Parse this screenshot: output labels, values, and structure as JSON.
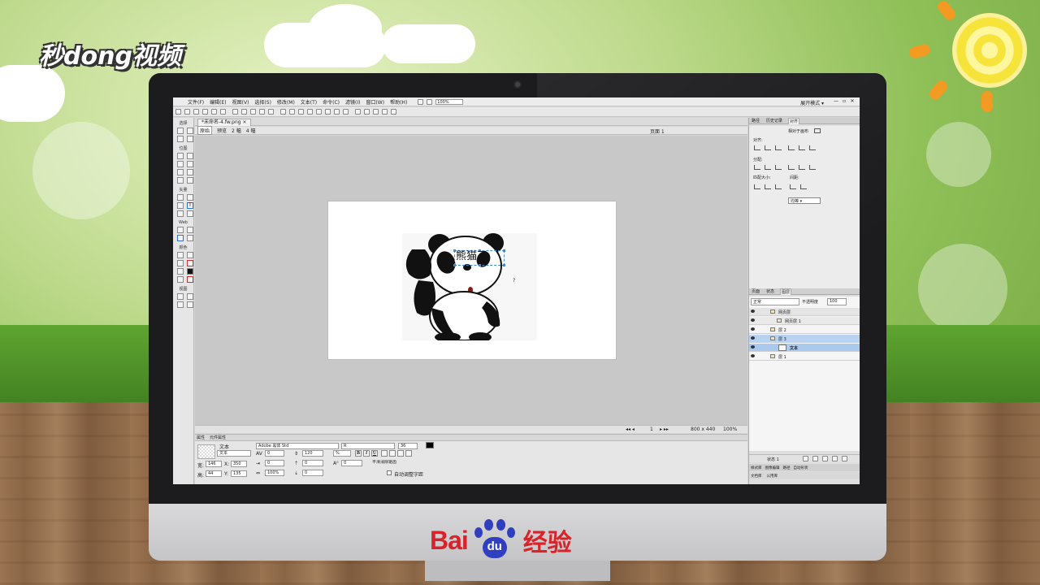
{
  "brand": {
    "logo_text": "秒dong视频"
  },
  "watermark": {
    "bai": "Bai",
    "du": "du",
    "jingyan": "经验"
  },
  "app": {
    "menu": [
      "文件(F)",
      "编辑(E)",
      "视图(V)",
      "选择(S)",
      "修改(M)",
      "文本(T)",
      "命令(C)",
      "滤镜(I)",
      "窗口(W)",
      "帮助(H)"
    ],
    "zoom": "100%",
    "workspace_mode": "展开模式 ▾",
    "window_buttons": [
      "—",
      "▫",
      "✕"
    ],
    "doc_tab": "*未命名-4.fw.png ×",
    "views": {
      "original": "原始",
      "preview": "预览",
      "two_up": "2 幅",
      "four_up": "4 幅"
    },
    "page_selector": "页面 1",
    "canvas_text": "熊猫了",
    "cursor_glyph": "?",
    "status": {
      "frame": "1",
      "size": "800 x 440",
      "zoom": "100%"
    }
  },
  "tools": {
    "select": "选择",
    "bitmap": "位图",
    "vector": "矢量",
    "web": "Web",
    "colors": "颜色",
    "view": "视图",
    "text_tool_glyph": "T"
  },
  "properties": {
    "tabs": [
      "属性",
      "元件属性"
    ],
    "type_label": "文本",
    "name_value": "文本",
    "font_family": "Adobe 黑体 Std",
    "font_style": "R",
    "font_size": "36",
    "kerning": "0",
    "leading": "120",
    "leading_unit": "%",
    "bold": "B",
    "italic": "I",
    "underline": "U",
    "indent": "0",
    "space_before": "0",
    "space_after": "0",
    "scale": "100%",
    "baseline": "0",
    "antialias": "平滑消除锯齿",
    "auto_kern": "自动调整字距",
    "w_label": "宽:",
    "w": "146",
    "h_label": "高:",
    "h": "44",
    "x_label": "X:",
    "x": "350",
    "y_label": "Y:",
    "y": "135"
  },
  "align_panel": {
    "tabs": [
      "路径",
      "历史记录",
      "对齐"
    ],
    "to_canvas": "相对于画布",
    "align": "对齐:",
    "distribute": "分配:",
    "match_size": "匹配大小:",
    "spacing": "间距:",
    "spacing_value": "均等 ▾"
  },
  "layers_panel": {
    "tabs": [
      "页面",
      "状态",
      "图层"
    ],
    "blend_mode": "正常",
    "opacity_label": "不透明度",
    "opacity": "100",
    "layers": [
      {
        "name": "网页层"
      },
      {
        "name": "网页层 1"
      },
      {
        "name": "层 2"
      },
      {
        "name": "层 3"
      },
      {
        "name": "文本"
      },
      {
        "name": "层 1"
      }
    ],
    "state": "状态 1",
    "bottom_tabs": [
      "样式库",
      "图像编辑",
      "路径",
      "自动形状"
    ],
    "bottom_tabs2": [
      "文档库",
      "公用库"
    ]
  }
}
